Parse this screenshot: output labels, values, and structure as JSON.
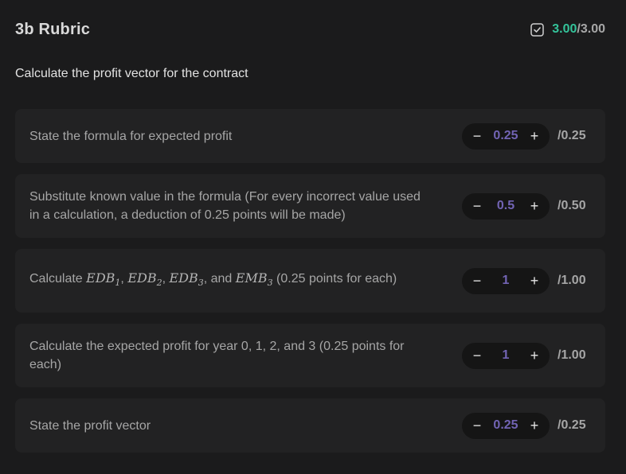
{
  "header": {
    "title": "3b Rubric",
    "score_got": "3.00",
    "score_sep": "/",
    "score_max": "3.00"
  },
  "prompt": "Calculate the profit vector for the contract",
  "colors": {
    "accent_score": "#34c39a",
    "stepper_value": "#7264b4"
  },
  "criteria": [
    {
      "text": "State the formula for expected profit",
      "value": "0.25",
      "max": "/0.25"
    },
    {
      "text": "Substitute known value in the formula (For every incorrect value used in a calculation, a deduction of 0.25 points will be made)",
      "value": "0.5",
      "max": "/0.50"
    },
    {
      "text_prefix": "Calculate ",
      "math": [
        {
          "base": "EDB",
          "sub": "1"
        },
        {
          "base": "EDB",
          "sub": "2"
        },
        {
          "base": "EDB",
          "sub": "3"
        },
        {
          "base": "EMB",
          "sub": "3"
        }
      ],
      "sep1": ", ",
      "sep2": ", ",
      "sep3": ", and ",
      "text_suffix": " (0.25 points for each)",
      "value": "1",
      "max": "/1.00"
    },
    {
      "text": "Calculate the expected profit for year 0, 1, 2, and 3 (0.25 points for each)",
      "value": "1",
      "max": "/1.00"
    },
    {
      "text": "State the profit vector",
      "value": "0.25",
      "max": "/0.25"
    }
  ],
  "icons": {
    "minus": "−",
    "plus": "+"
  }
}
